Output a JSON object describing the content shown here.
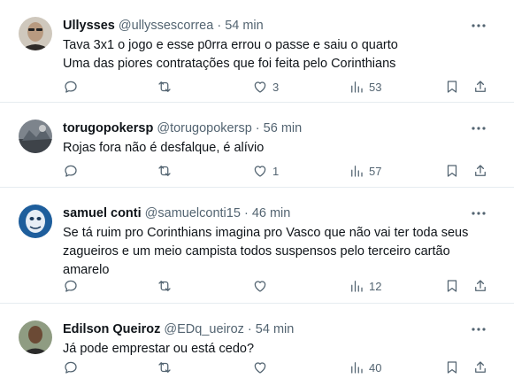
{
  "tweets": [
    {
      "name": "Ullysses",
      "handle": "@ullyssescorrea",
      "sep": "·",
      "time": "54 min",
      "lines": [
        "Tava 3x1 o jogo e esse p0rra errou o passe e saiu o quarto",
        "Uma das piores contratações que foi feita pelo Corinthians"
      ],
      "likes": "3",
      "views": "53",
      "avatar_colors": [
        "#c9c2b8",
        "#5b4a3d"
      ]
    },
    {
      "name": "torugopokersp",
      "handle": "@torugopokersp",
      "sep": "·",
      "time": "56 min",
      "lines": [
        "Rojas fora não é desfalque, é alívio"
      ],
      "likes": "1",
      "views": "57",
      "avatar_colors": [
        "#8a9099",
        "#3b3f45"
      ]
    },
    {
      "name": "samuel conti",
      "handle": "@samuelconti15",
      "sep": "·",
      "time": "46 min",
      "lines": [
        "Se tá ruim pro Corinthians imagina pro Vasco que não vai ter toda seus",
        "zagueiros e um meio campista todos suspensos pelo terceiro cartão",
        "amarelo"
      ],
      "likes": "",
      "views": "12",
      "avatar_colors": [
        "#2a6fb0",
        "#d7e3ef"
      ]
    },
    {
      "name": "Edilson Queiroz",
      "handle": "@EDq_ueiroz",
      "sep": "·",
      "time": "54 min",
      "lines": [
        "Já pode emprestar ou está cedo?"
      ],
      "likes": "",
      "views": "40",
      "avatar_colors": [
        "#7d8a70",
        "#3a3a3a"
      ]
    }
  ],
  "colors": {
    "text": "#0f1419",
    "secondary": "#536471",
    "divider": "#e6ecf0"
  },
  "icons": [
    "reply-icon",
    "retweet-icon",
    "like-icon",
    "views-icon",
    "bookmark-icon",
    "share-icon",
    "more-icon"
  ]
}
